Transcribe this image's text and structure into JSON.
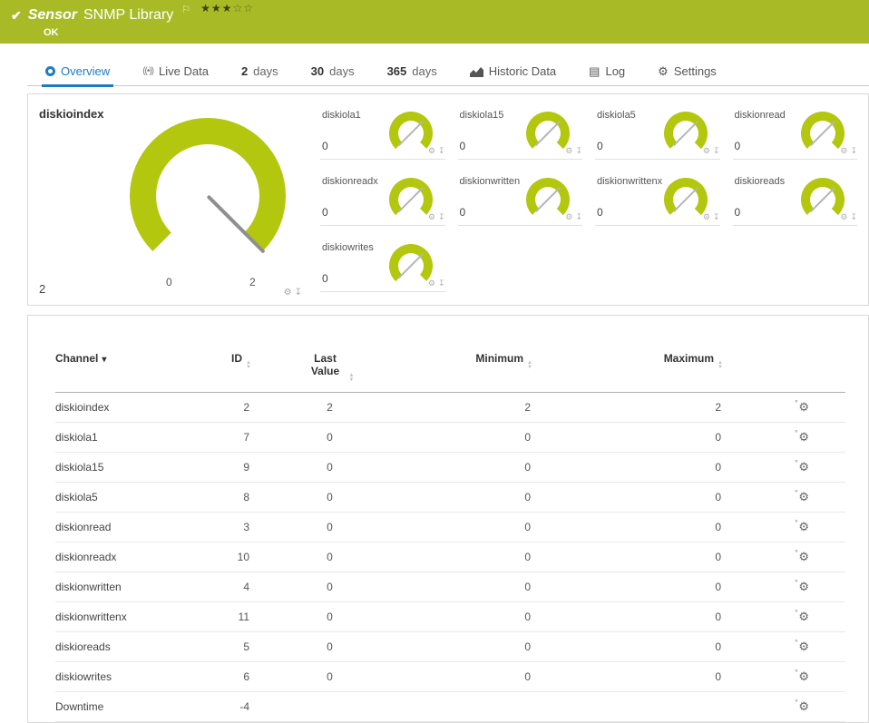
{
  "colors": {
    "header_green": "#a8bb27",
    "gauge_green": "#b2c70d",
    "tab_blue": "#1e7bc0"
  },
  "icons": {
    "check": "✔",
    "flag": "⚐",
    "gear": "⚙",
    "pin": "↧",
    "row_gear": "⚙",
    "log": "▤",
    "settings": "⚙",
    "live": "((•))",
    "sort_up": "▲",
    "sort_down": "▼",
    "caret_down": "▾"
  },
  "header": {
    "title_prefix": "Sensor",
    "title": "SNMP Library",
    "status": "OK",
    "stars_filled": "★★★",
    "stars_empty": "☆☆"
  },
  "tabs": [
    {
      "label": "Overview"
    },
    {
      "label": "Live Data"
    },
    {
      "number": "2",
      "label": "days"
    },
    {
      "number": "30",
      "label": "days"
    },
    {
      "number": "365",
      "label": "days"
    },
    {
      "label": "Historic Data"
    },
    {
      "label": "Log"
    },
    {
      "label": "Settings"
    }
  ],
  "gauges": {
    "primary": {
      "label": "diskioindex",
      "value": "2",
      "scale_min": "0",
      "scale_max": "2"
    },
    "small": [
      {
        "label": "diskiola1",
        "value": "0"
      },
      {
        "label": "diskiola15",
        "value": "0"
      },
      {
        "label": "diskiola5",
        "value": "0"
      },
      {
        "label": "diskionread",
        "value": "0"
      },
      {
        "label": "diskionreadx",
        "value": "0"
      },
      {
        "label": "diskionwritten",
        "value": "0"
      },
      {
        "label": "diskionwrittenx",
        "value": "0"
      },
      {
        "label": "diskioreads",
        "value": "0"
      },
      {
        "label": "diskiowrites",
        "value": "0"
      }
    ]
  },
  "table": {
    "columns": [
      "Channel",
      "ID",
      "Last Value",
      "Minimum",
      "Maximum"
    ],
    "rows": [
      {
        "channel": "diskioindex",
        "id": "2",
        "last": "2",
        "min": "2",
        "max": "2"
      },
      {
        "channel": "diskiola1",
        "id": "7",
        "last": "0",
        "min": "0",
        "max": "0"
      },
      {
        "channel": "diskiola15",
        "id": "9",
        "last": "0",
        "min": "0",
        "max": "0"
      },
      {
        "channel": "diskiola5",
        "id": "8",
        "last": "0",
        "min": "0",
        "max": "0"
      },
      {
        "channel": "diskionread",
        "id": "3",
        "last": "0",
        "min": "0",
        "max": "0"
      },
      {
        "channel": "diskionreadx",
        "id": "10",
        "last": "0",
        "min": "0",
        "max": "0"
      },
      {
        "channel": "diskionwritten",
        "id": "4",
        "last": "0",
        "min": "0",
        "max": "0"
      },
      {
        "channel": "diskionwrittenx",
        "id": "11",
        "last": "0",
        "min": "0",
        "max": "0"
      },
      {
        "channel": "diskioreads",
        "id": "5",
        "last": "0",
        "min": "0",
        "max": "0"
      },
      {
        "channel": "diskiowrites",
        "id": "6",
        "last": "0",
        "min": "0",
        "max": "0"
      },
      {
        "channel": "Downtime",
        "id": "-4",
        "last": "",
        "min": "",
        "max": ""
      }
    ]
  }
}
